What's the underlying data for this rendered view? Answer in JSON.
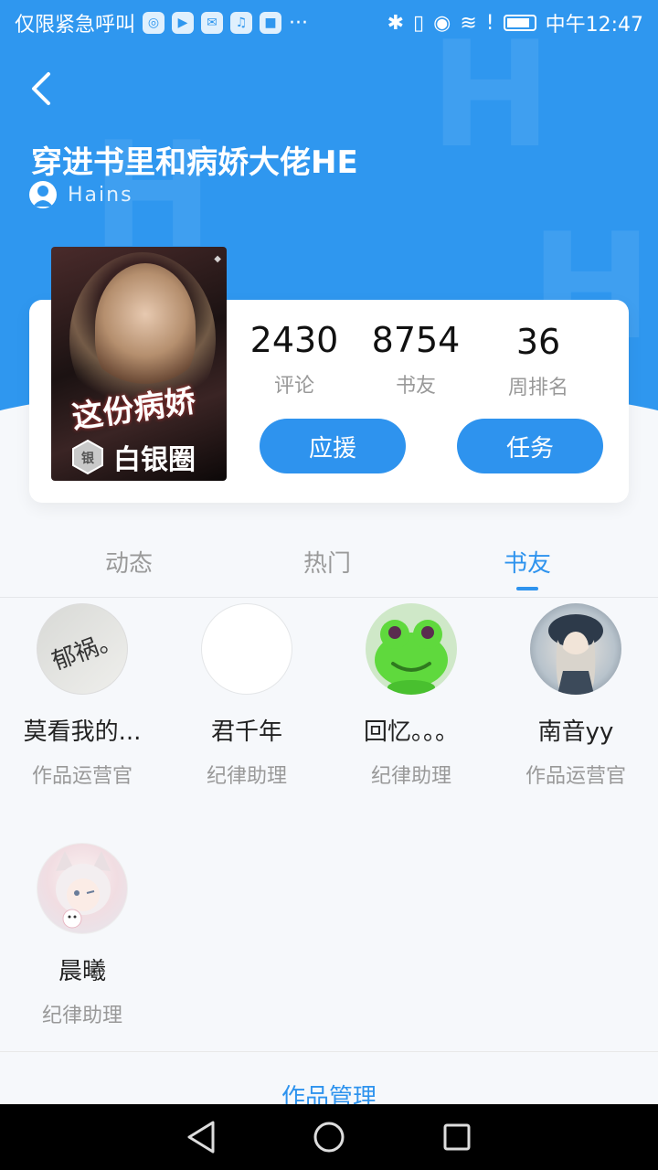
{
  "status_bar": {
    "carrier": "仅限紧急呼叫",
    "more": "···",
    "time": "中午12:47"
  },
  "book": {
    "title": "穿进书里和病娇大佬HE",
    "author": "Hains",
    "cover_title": "这份病娇",
    "badge": "白银圈",
    "badge_icon_text": "银"
  },
  "stats": [
    {
      "value": "2430",
      "label": "评论"
    },
    {
      "value": "8754",
      "label": "书友"
    },
    {
      "value": "36",
      "label": "周排名"
    }
  ],
  "actions": {
    "cheer": "应援",
    "task": "任务"
  },
  "tabs": [
    {
      "label": "动态"
    },
    {
      "label": "热门"
    },
    {
      "label": "书友",
      "active": true
    }
  ],
  "members": [
    {
      "name": "莫看我的...",
      "role": "作品运营官",
      "avatar_text": "郁祸。"
    },
    {
      "name": "君千年",
      "role": "纪律助理"
    },
    {
      "name": "回忆。。。",
      "role": "纪律助理"
    },
    {
      "name": "南音yy",
      "role": "作品运营官"
    },
    {
      "name": "晨曦",
      "role": "纪律助理"
    }
  ],
  "footer": {
    "manage": "作品管理"
  },
  "colors": {
    "primary": "#2f97ef",
    "button": "#2e93ee",
    "muted": "#999999"
  }
}
